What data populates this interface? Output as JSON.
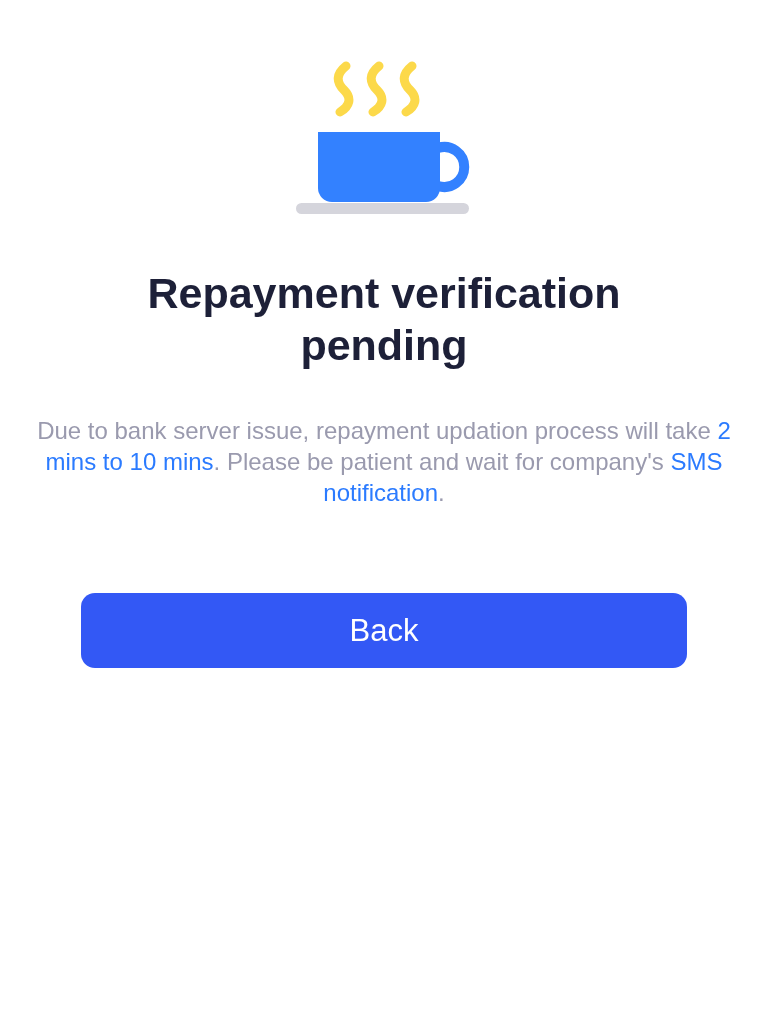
{
  "title": "Repayment verification pending",
  "message": [
    {
      "text": "Due to bank server issue, repayment updation process will take ",
      "highlight": false
    },
    {
      "text": "2 mins to 10 mins",
      "highlight": true
    },
    {
      "text": ". Please be patient and wait for company's ",
      "highlight": false
    },
    {
      "text": "SMS notification",
      "highlight": true
    },
    {
      "text": ".",
      "highlight": false
    }
  ],
  "button": {
    "label": "Back"
  }
}
